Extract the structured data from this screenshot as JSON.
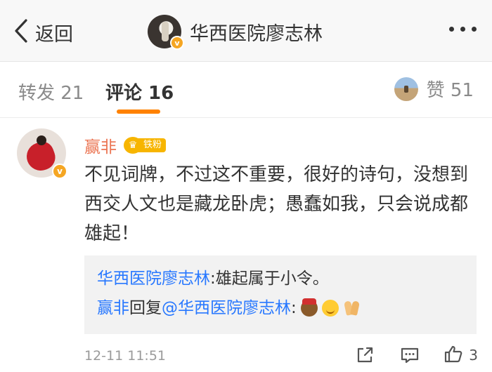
{
  "nav": {
    "back_label": "返回",
    "title": "华西医院廖志林",
    "verified_mark": "v",
    "more_icon": "more-dots-icon"
  },
  "tabs": {
    "repost": "转发 21",
    "comment": "评论 16",
    "like": "赞 51"
  },
  "comment": {
    "author": "赢非",
    "verified_mark": "v",
    "fan_badge": {
      "crown": "♛",
      "label": "铁粉"
    },
    "text": "不见词牌，不过这不重要，很好的诗句，没想到西交人文也是藏龙卧虎；愚蠢如我，只会说成都雄起！",
    "replies": [
      {
        "user": "华西医院廖志林",
        "sep": ": ",
        "text": "雄起属于小令。"
      },
      {
        "user": "赢非",
        "verb": "回复",
        "target": "@华西医院廖志林",
        "sep": ":",
        "emoji": [
          "emoji-face-hat",
          "emoji-smile",
          "emoji-praying-hands"
        ]
      }
    ],
    "time": "12-11 11:51",
    "like_count": "3"
  },
  "colors": {
    "accent": "#ff8200",
    "name": "#eb7350",
    "link": "#2878ff",
    "badge": "#f7b500"
  }
}
